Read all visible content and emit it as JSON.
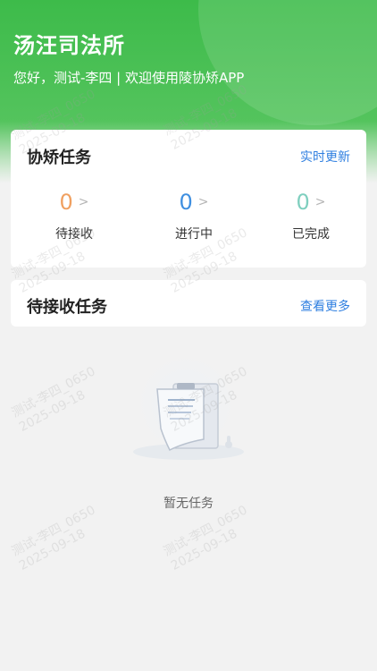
{
  "header": {
    "title": "汤汪司法所",
    "greeting": "您好，测试-李四 | 欢迎使用陵协矫APP"
  },
  "task_card": {
    "title": "协矫任务",
    "link": "实时更新",
    "stats": [
      {
        "value": "0",
        "label": "待接收",
        "color": "#f0a060"
      },
      {
        "value": "0",
        "label": "进行中",
        "color": "#3f8fe0"
      },
      {
        "value": "0",
        "label": "已完成",
        "color": "#7fcfbf"
      }
    ],
    "arrow": ">"
  },
  "pending_card": {
    "title": "待接收任务",
    "link": "查看更多"
  },
  "empty_state": {
    "text": "暂无任务",
    "icon": "clipboard-document-icon"
  },
  "watermark": {
    "line1": "测试-李四_0650",
    "line2": "2025-09-18"
  }
}
